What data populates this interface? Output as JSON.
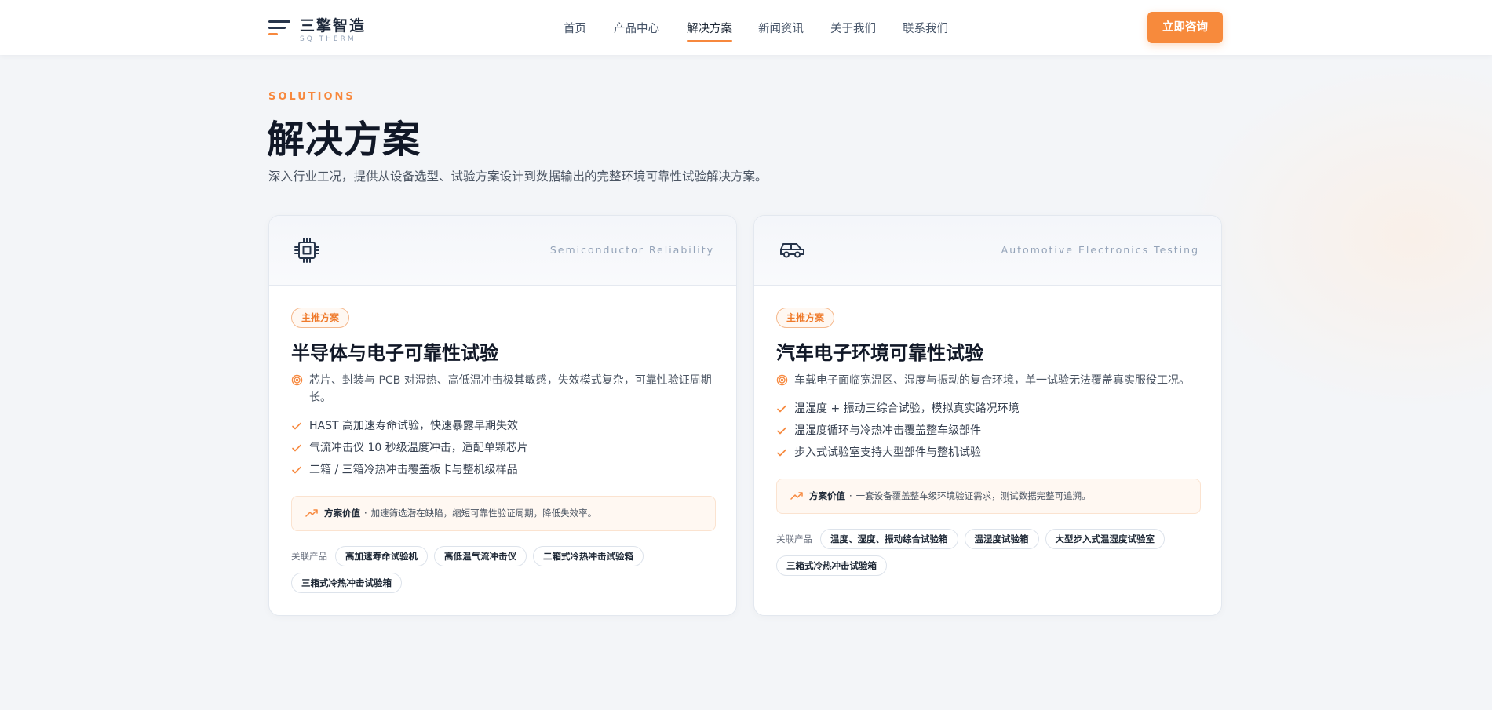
{
  "brand": {
    "name": "三擎智造",
    "sub": "SQ THERM"
  },
  "nav": {
    "items": [
      {
        "label": "首页"
      },
      {
        "label": "产品中心"
      },
      {
        "label": "解决方案"
      },
      {
        "label": "新闻资讯"
      },
      {
        "label": "关于我们"
      },
      {
        "label": "联系我们"
      }
    ],
    "active": "解决方案",
    "cta_label": "立即咨询"
  },
  "hero": {
    "eyebrow": "SOLUTIONS",
    "title": "解决方案",
    "description": "深入行业工况，提供从设备选型、试验方案设计到数据输出的完整环境可靠性试验解决方案。"
  },
  "colors": {
    "accent": "#f78a3c",
    "dark": "#111827",
    "muted": "#94a3b8"
  },
  "cards": [
    {
      "icon": "chip-icon",
      "en_title": "Semiconductor Reliability",
      "badge": "主推方案",
      "title": "半导体与电子可靠性试验",
      "pain_icon": "target-icon",
      "pain": "芯片、封装与 PCB 对湿热、高低温冲击极其敏感，失效模式复杂，可靠性验证周期长。",
      "features": [
        "HAST 高加速寿命试验，快速暴露早期失效",
        "气流冲击仪 10 秒级温度冲击，适配单颗芯片",
        "二箱 / 三箱冷热冲击覆盖板卡与整机级样品"
      ],
      "value_label": "方案价值",
      "value_sep": "·",
      "value_text": "加速筛选潜在缺陷，缩短可靠性验证周期，降低失效率。",
      "products_label": "关联产品",
      "products": [
        "高加速寿命试验机",
        "高低温气流冲击仪",
        "二箱式冷热冲击试验箱",
        "三箱式冷热冲击试验箱"
      ]
    },
    {
      "icon": "car-icon",
      "en_title": "Automotive Electronics Testing",
      "badge": "主推方案",
      "title": "汽车电子环境可靠性试验",
      "pain_icon": "target-icon",
      "pain": "车载电子面临宽温区、湿度与振动的复合环境，单一试验无法覆盖真实服役工况。",
      "features": [
        "温湿度 + 振动三综合试验，模拟真实路况环境",
        "温湿度循环与冷热冲击覆盖整车级部件",
        "步入式试验室支持大型部件与整机试验"
      ],
      "value_label": "方案价值",
      "value_sep": "·",
      "value_text": "一套设备覆盖整车级环境验证需求，测试数据完整可追溯。",
      "products_label": "关联产品",
      "products": [
        "温度、湿度、振动综合试验箱",
        "温湿度试验箱",
        "大型步入式温湿度试验室",
        "三箱式冷热冲击试验箱"
      ]
    }
  ]
}
